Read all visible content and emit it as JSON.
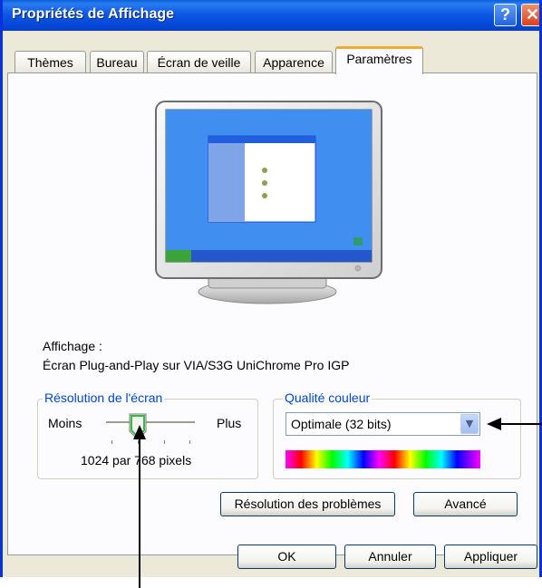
{
  "window": {
    "title": "Propriétés de Affichage",
    "help_label": "?",
    "close_label": "✕"
  },
  "tabs": [
    {
      "label": "Thèmes",
      "active": false
    },
    {
      "label": "Bureau",
      "active": false
    },
    {
      "label": "Écran de veille",
      "active": false
    },
    {
      "label": "Apparence",
      "active": false
    },
    {
      "label": "Paramètres",
      "active": true
    }
  ],
  "display": {
    "heading": "Affichage :",
    "device": "Écran Plug-and-Play sur VIA/S3G UniChrome Pro IGP"
  },
  "resolution": {
    "group_label": "Résolution de l'écran",
    "min_label": "Moins",
    "max_label": "Plus",
    "value_text": "1024 par 768 pixels"
  },
  "color_quality": {
    "group_label": "Qualité couleur",
    "selected": "Optimale (32 bits)"
  },
  "buttons": {
    "troubleshoot": "Résolution des problèmes",
    "advanced": "Avancé",
    "ok": "OK",
    "cancel": "Annuler",
    "apply": "Appliquer"
  },
  "icons": {
    "help": "help-icon",
    "close": "close-icon",
    "dropdown": "chevron-down-icon",
    "monitor": "monitor-icon"
  },
  "colors": {
    "title_bar": "#0a5fd8",
    "dialog_bg": "#ece9d8",
    "tab_accent": "#f5a830",
    "groupbox_label": "#0046d5"
  }
}
